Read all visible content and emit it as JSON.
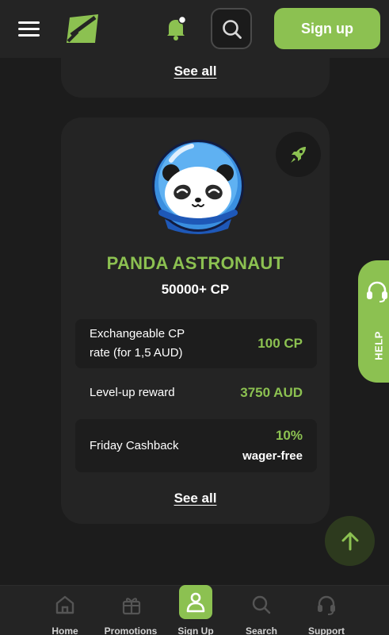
{
  "header": {
    "signup_label": "Sign up"
  },
  "top_card": {
    "see_all": "See all"
  },
  "level_card": {
    "name": "PANDA ASTRONAUT",
    "cp": "50000+ CP",
    "rows": [
      {
        "label": "Exchangeable CP rate (for 1,5 AUD)",
        "value": "100 CP"
      },
      {
        "label": "Level-up reward",
        "value": "3750 AUD"
      },
      {
        "label": "Friday Cashback",
        "value": "10%",
        "sub": "wager-free"
      }
    ],
    "see_all": "See all"
  },
  "help_tab": {
    "label": "HELP"
  },
  "bottom_nav": {
    "items": [
      {
        "label": "Home",
        "icon": "home-icon"
      },
      {
        "label": "Promotions",
        "icon": "gift-icon"
      },
      {
        "label": "Sign Up",
        "icon": "user-icon",
        "active": true
      },
      {
        "label": "Search",
        "icon": "search-icon"
      },
      {
        "label": "Support",
        "icon": "headset-icon"
      }
    ]
  },
  "colors": {
    "accent": "#8cc151",
    "background": "#1c1c1c",
    "card": "#242424"
  }
}
